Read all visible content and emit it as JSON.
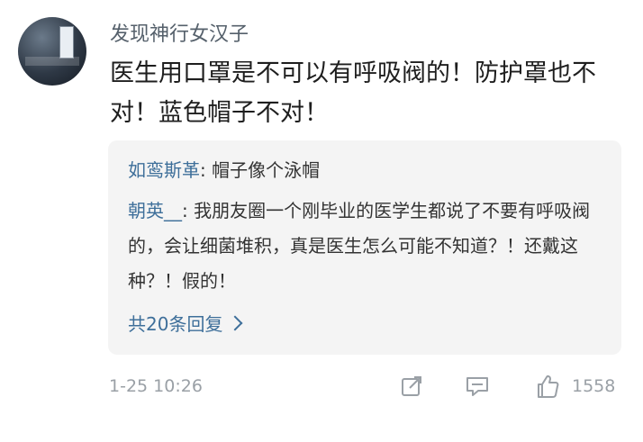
{
  "post": {
    "username": "发现神行女汉子",
    "content": "医生用口罩是不可以有呼吸阀的！防护罩也不对！蓝色帽子不对！",
    "replies": [
      {
        "name": "如鸾斯革",
        "text": "帽子像个泳帽"
      },
      {
        "name": "朝英__",
        "text": "我朋友圈一个刚毕业的医学生都说了不要有呼吸阀的，会让细菌堆积，真是医生怎么可能不知道？！还戴这种？！假的！"
      }
    ],
    "more_replies": "共20条回复",
    "timestamp": "1-25 10:26",
    "likes": "1558"
  },
  "icons": [
    "share-icon",
    "comment-icon",
    "like-icon",
    "chevron-right-icon"
  ],
  "colors": {
    "link": "#3e6f9a",
    "meta": "#9aa0a6",
    "reply_bg": "#f4f4f4"
  }
}
